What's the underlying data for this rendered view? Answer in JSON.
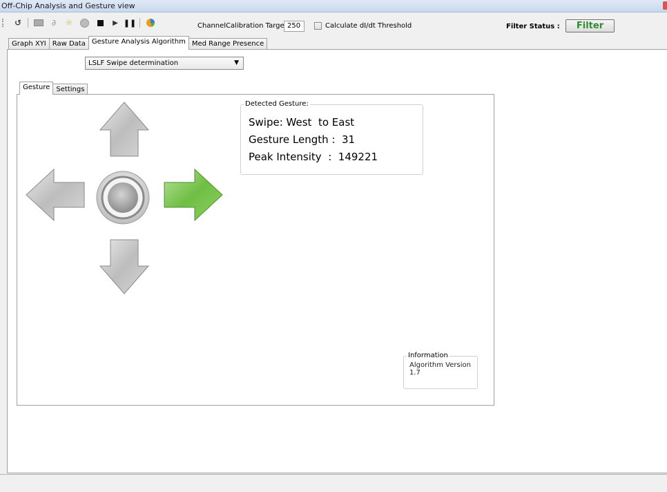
{
  "window": {
    "title": "Off-Chip Analysis and Gesture view"
  },
  "toolbar": {
    "calibration_label": "ChannelCalibration Target",
    "calibration_value": "250",
    "threshold_label": "Calculate dI/dt Threshold",
    "filter_status_label": "Filter Status :",
    "filter_button": "Filter"
  },
  "main_tabs": [
    "Graph XYI",
    "Raw Data",
    "Gesture Analysis Algorithm",
    "Med Range Presence"
  ],
  "algorithm_select": {
    "selected": "LSLF Swipe determination"
  },
  "sub_tabs": [
    "Gesture",
    "Settings"
  ],
  "detected": {
    "legend": "Detected Gesture:",
    "swipe": "Swipe: West  to East",
    "length": "Gesture Length :  31",
    "peak": "Peak Intensity  :  149221"
  },
  "info": {
    "legend": "Information",
    "line1": "Algorithm Version",
    "line2": "1.7"
  },
  "arrows": {
    "up": "inactive",
    "down": "inactive",
    "left": "inactive",
    "right": "active",
    "active_color": "#6fbe44",
    "inactive_color": "#c8c8c8"
  }
}
